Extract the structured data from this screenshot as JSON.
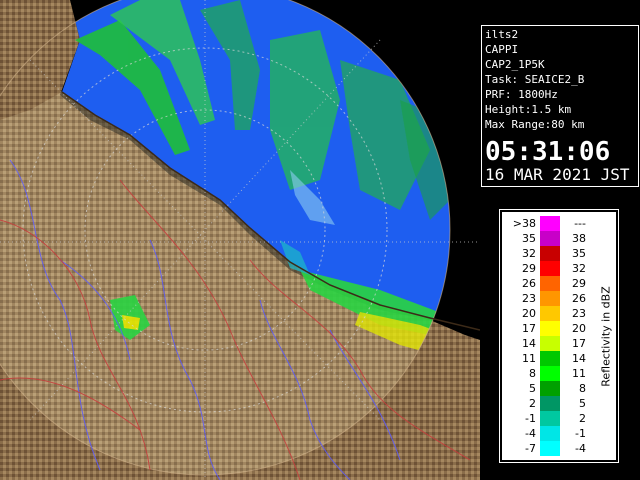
{
  "info_panel": {
    "lines": [
      "ilts2",
      "CAPPI",
      "CAP2_1P5K",
      "Task: SEAICE2_B",
      "PRF: 1800Hz",
      "Height:1.5 km",
      "Max Range:80 km"
    ],
    "time": "05:31:06",
    "date": "16 MAR 2021 JST"
  },
  "legend": {
    "title": "Reflectivity in dBZ",
    "rows": [
      {
        "left": ">38",
        "right": "---",
        "color": "#ff00ff"
      },
      {
        "left": "35",
        "right": "38",
        "color": "#c800c8"
      },
      {
        "left": "32",
        "right": "35",
        "color": "#c80000"
      },
      {
        "left": "29",
        "right": "32",
        "color": "#ff0000"
      },
      {
        "left": "26",
        "right": "29",
        "color": "#ff6400"
      },
      {
        "left": "23",
        "right": "26",
        "color": "#ff9600"
      },
      {
        "left": "20",
        "right": "23",
        "color": "#ffc800"
      },
      {
        "left": "17",
        "right": "20",
        "color": "#ffff00"
      },
      {
        "left": "14",
        "right": "17",
        "color": "#c8ff00"
      },
      {
        "left": "11",
        "right": "14",
        "color": "#00c800"
      },
      {
        "left": "8",
        "right": "11",
        "color": "#00ff00"
      },
      {
        "left": "5",
        "right": "8",
        "color": "#00a000"
      },
      {
        "left": "2",
        "right": "5",
        "color": "#009664"
      },
      {
        "left": "-1",
        "right": "2",
        "color": "#00c8a0"
      },
      {
        "left": "-4",
        "right": "-1",
        "color": "#00e6e6"
      },
      {
        "left": "-7",
        "right": "-4",
        "color": "#00ffff"
      }
    ]
  },
  "colors": {
    "sea": "#1e64f0",
    "land": "#8c7250",
    "range_ring": "#d2b48c",
    "rivers": "#5050ff",
    "borders": "#c83232"
  }
}
